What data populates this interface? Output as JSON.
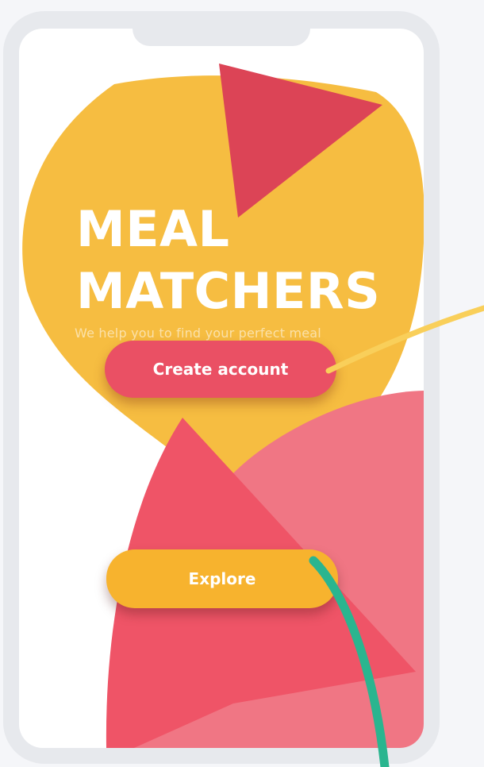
{
  "app": {
    "title_line1": "MEAL",
    "title_line2": "MATCHERS",
    "tagline": "We help you to find your perfect meal"
  },
  "actions": {
    "create_account_label": "Create account",
    "explore_label": "Explore"
  },
  "colors": {
    "background": "#f5f6f9",
    "phone_frame": "#e7e9ed",
    "screen": "#ffffff",
    "yellow_blob": "#f6bd41",
    "red_accent": "#dc4456",
    "coral": "#ef5467",
    "pink": "#f07684",
    "create_button": "#ea5064",
    "explore_button": "#f7b32e",
    "teal_line": "#2ab58f",
    "yellow_line": "#f9cf5a"
  }
}
